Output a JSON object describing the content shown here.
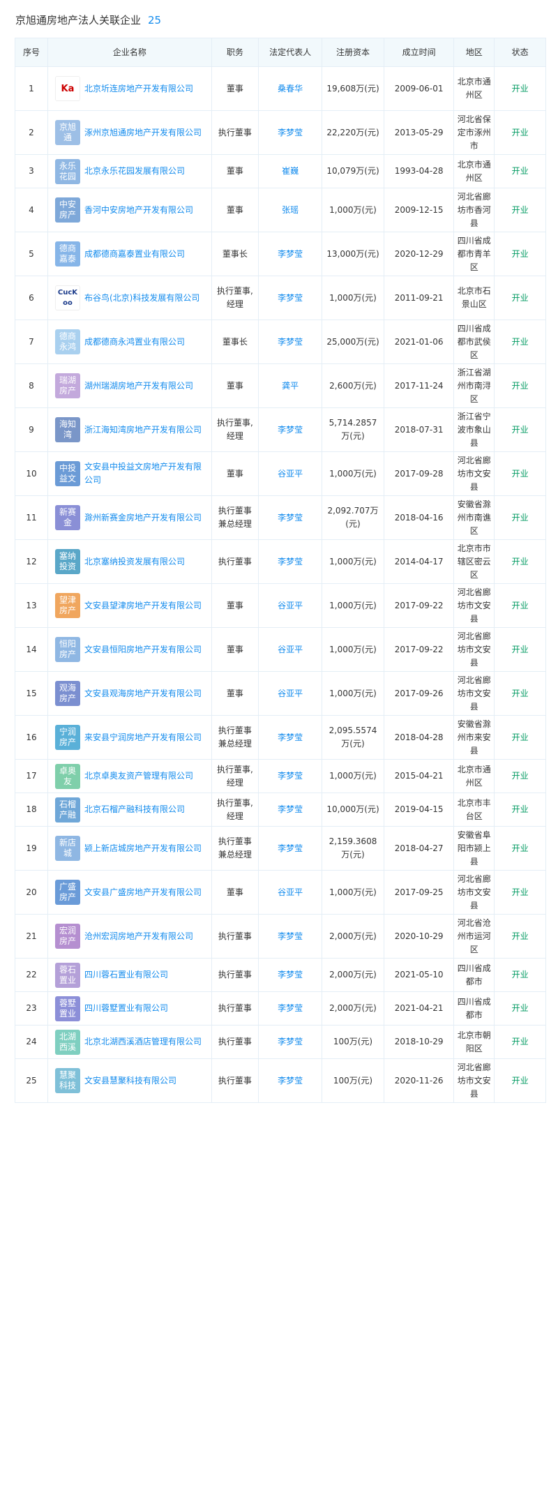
{
  "header": {
    "title": "京旭通房地产法人关联企业",
    "count": "25"
  },
  "columns": [
    "序号",
    "企业名称",
    "职务",
    "法定代表人",
    "注册资本",
    "成立时间",
    "地区",
    "状态"
  ],
  "rows": [
    {
      "no": "1",
      "logo": "Ka",
      "logo_type": "img",
      "logo_color": "#ffffff",
      "name": "北京圻连房地产开发有限公司",
      "role": "董事",
      "rep": "桑春华",
      "capital": "19,608万(元)",
      "date": "2009-06-01",
      "region": "北京市通州区",
      "status": "开业",
      "h": 63
    },
    {
      "no": "2",
      "logo": "京旭通",
      "logo_type": "text",
      "logo_color": "#9dbfe6",
      "name": "涿州京旭通房地产开发有限公司",
      "role": "执行董事",
      "rep": "李梦莹",
      "capital": "22,220万(元)",
      "date": "2013-05-29",
      "region": "河北省保定市涿州市",
      "status": "开业",
      "h": 63
    },
    {
      "no": "3",
      "logo": "永乐花园",
      "logo_type": "text",
      "logo_color": "#8fb7e3",
      "name": "北京永乐花园发展有限公司",
      "role": "董事",
      "rep": "崔巍",
      "capital": "10,079万(元)",
      "date": "1993-04-28",
      "region": "北京市通州区",
      "status": "开业",
      "h": 48
    },
    {
      "no": "4",
      "logo": "中安房产",
      "logo_type": "text",
      "logo_color": "#7ea8d9",
      "name": "香河中安房地产开发有限公司",
      "role": "董事",
      "rep": "张瑶",
      "capital": "1,000万(元)",
      "date": "2009-12-15",
      "region": "河北省廊坊市香河县",
      "status": "开业",
      "h": 63
    },
    {
      "no": "5",
      "logo": "德商嘉泰",
      "logo_type": "text",
      "logo_color": "#86b5e8",
      "name": "成都德商嘉泰置业有限公司",
      "role": "董事长",
      "rep": "李梦莹",
      "capital": "13,000万(元)",
      "date": "2020-12-29",
      "region": "四川省成都市青羊区",
      "status": "开业",
      "h": 63
    },
    {
      "no": "6",
      "logo": "CucKoo",
      "logo_type": "img2",
      "logo_color": "#ffffff",
      "name": "布谷鸟(北京)科技发展有限公司",
      "role": "执行董事,经理",
      "rep": "李梦莹",
      "capital": "1,000万(元)",
      "date": "2011-09-21",
      "region": "北京市石景山区",
      "status": "开业",
      "h": 63
    },
    {
      "no": "7",
      "logo": "德商永鸿",
      "logo_type": "text",
      "logo_color": "#a9d0ef",
      "name": "成都德商永鸿置业有限公司",
      "role": "董事长",
      "rep": "李梦莹",
      "capital": "25,000万(元)",
      "date": "2021-01-06",
      "region": "四川省成都市武侯区",
      "status": "开业",
      "h": 63
    },
    {
      "no": "8",
      "logo": "瑞湖房产",
      "logo_type": "text",
      "logo_color": "#c3a9dc",
      "name": "湖州瑞湖房地产开发有限公司",
      "role": "董事",
      "rep": "龚平",
      "capital": "2,600万(元)",
      "date": "2017-11-24",
      "region": "浙江省湖州市南浔区",
      "status": "开业",
      "h": 63
    },
    {
      "no": "9",
      "logo": "海知湾",
      "logo_type": "text",
      "logo_color": "#7a96c8",
      "name": "浙江海知湾房地产开发有限公司",
      "role": "执行董事,经理",
      "rep": "李梦莹",
      "capital": "5,714.2857万(元)",
      "date": "2018-07-31",
      "region": "浙江省宁波市象山县",
      "status": "开业",
      "h": 63
    },
    {
      "no": "10",
      "logo": "中投益文",
      "logo_type": "text",
      "logo_color": "#6b9bd6",
      "name": "文安县中投益文房地产开发有限公司",
      "role": "董事",
      "rep": "谷亚平",
      "capital": "1,000万(元)",
      "date": "2017-09-28",
      "region": "河北省廊坊市文安县",
      "status": "开业",
      "h": 63
    },
    {
      "no": "11",
      "logo": "新赛金",
      "logo_type": "text",
      "logo_color": "#8a8fd6",
      "name": "滁州新赛金房地产开发有限公司",
      "role": "执行董事兼总经理",
      "rep": "李梦莹",
      "capital": "2,092.707万(元)",
      "date": "2018-04-16",
      "region": "安徽省滁州市南谯区",
      "status": "开业",
      "h": 63
    },
    {
      "no": "12",
      "logo": "塞纳投资",
      "logo_type": "text",
      "logo_color": "#5aa7c8",
      "name": "北京塞纳投资发展有限公司",
      "role": "执行董事",
      "rep": "李梦莹",
      "capital": "1,000万(元)",
      "date": "2014-04-17",
      "region": "北京市市辖区密云区",
      "status": "开业",
      "h": 63
    },
    {
      "no": "13",
      "logo": "望津房产",
      "logo_type": "text",
      "logo_color": "#f0a65e",
      "name": "文安县望津房地产开发有限公司",
      "role": "董事",
      "rep": "谷亚平",
      "capital": "1,000万(元)",
      "date": "2017-09-22",
      "region": "河北省廊坊市文安县",
      "status": "开业",
      "h": 63
    },
    {
      "no": "14",
      "logo": "恒阳房产",
      "logo_type": "text",
      "logo_color": "#8fb7e3",
      "name": "文安县恒阳房地产开发有限公司",
      "role": "董事",
      "rep": "谷亚平",
      "capital": "1,000万(元)",
      "date": "2017-09-22",
      "region": "河北省廊坊市文安县",
      "status": "开业",
      "h": 63
    },
    {
      "no": "15",
      "logo": "观海房产",
      "logo_type": "text",
      "logo_color": "#7b8fd0",
      "name": "文安县观海房地产开发有限公司",
      "role": "董事",
      "rep": "谷亚平",
      "capital": "1,000万(元)",
      "date": "2017-09-26",
      "region": "河北省廊坊市文安县",
      "status": "开业",
      "h": 63
    },
    {
      "no": "16",
      "logo": "宁润房产",
      "logo_type": "text",
      "logo_color": "#5ab0d8",
      "name": "来安县宁润房地产开发有限公司",
      "role": "执行董事兼总经理",
      "rep": "李梦莹",
      "capital": "2,095.5574万(元)",
      "date": "2018-04-28",
      "region": "安徽省滁州市来安县",
      "status": "开业",
      "h": 63
    },
    {
      "no": "17",
      "logo": "卓奥友",
      "logo_type": "text",
      "logo_color": "#7fcfaa",
      "name": "北京卓奥友资产管理有限公司",
      "role": "执行董事,经理",
      "rep": "李梦莹",
      "capital": "1,000万(元)",
      "date": "2015-04-21",
      "region": "北京市通州区",
      "status": "开业",
      "h": 48
    },
    {
      "no": "18",
      "logo": "石榴产融",
      "logo_type": "text",
      "logo_color": "#6fa7d8",
      "name": "北京石榴产融科技有限公司",
      "role": "执行董事,经理",
      "rep": "李梦莹",
      "capital": "10,000万(元)",
      "date": "2019-04-15",
      "region": "北京市丰台区",
      "status": "开业",
      "h": 48
    },
    {
      "no": "19",
      "logo": "新店城",
      "logo_type": "text",
      "logo_color": "#8fb7e3",
      "name": "颍上新店城房地产开发有限公司",
      "role": "执行董事兼总经理",
      "rep": "李梦莹",
      "capital": "2,159.3608万(元)",
      "date": "2018-04-27",
      "region": "安徽省阜阳市颍上县",
      "status": "开业",
      "h": 63
    },
    {
      "no": "20",
      "logo": "广盛房产",
      "logo_type": "text",
      "logo_color": "#6a9bd8",
      "name": "文安县广盛房地产开发有限公司",
      "role": "董事",
      "rep": "谷亚平",
      "capital": "1,000万(元)",
      "date": "2017-09-25",
      "region": "河北省廊坊市文安县",
      "status": "开业",
      "h": 63
    },
    {
      "no": "21",
      "logo": "宏润房产",
      "logo_type": "text",
      "logo_color": "#b58fd0",
      "name": "沧州宏润房地产开发有限公司",
      "role": "执行董事",
      "rep": "李梦莹",
      "capital": "2,000万(元)",
      "date": "2020-10-29",
      "region": "河北省沧州市运河区",
      "status": "开业",
      "h": 63
    },
    {
      "no": "22",
      "logo": "蓉石置业",
      "logo_type": "text",
      "logo_color": "#b4a0d8",
      "name": "四川蓉石置业有限公司",
      "role": "执行董事",
      "rep": "李梦莹",
      "capital": "2,000万(元)",
      "date": "2021-05-10",
      "region": "四川省成都市",
      "status": "开业",
      "h": 48
    },
    {
      "no": "23",
      "logo": "蓉墅置业",
      "logo_type": "text",
      "logo_color": "#8c8fd8",
      "name": "四川蓉墅置业有限公司",
      "role": "执行董事",
      "rep": "李梦莹",
      "capital": "2,000万(元)",
      "date": "2021-04-21",
      "region": "四川省成都市",
      "status": "开业",
      "h": 48
    },
    {
      "no": "24",
      "logo": "北湖西溪",
      "logo_type": "text",
      "logo_color": "#7fcfc0",
      "name": "北京北湖西溪酒店管理有限公司",
      "role": "执行董事",
      "rep": "李梦莹",
      "capital": "100万(元)",
      "date": "2018-10-29",
      "region": "北京市朝阳区",
      "status": "开业",
      "h": 48
    },
    {
      "no": "25",
      "logo": "慧聚科技",
      "logo_type": "text",
      "logo_color": "#7fc0d8",
      "name": "文安县慧聚科技有限公司",
      "role": "执行董事",
      "rep": "李梦莹",
      "capital": "100万(元)",
      "date": "2020-11-26",
      "region": "河北省廊坊市文安县",
      "status": "开业",
      "h": 63
    }
  ]
}
